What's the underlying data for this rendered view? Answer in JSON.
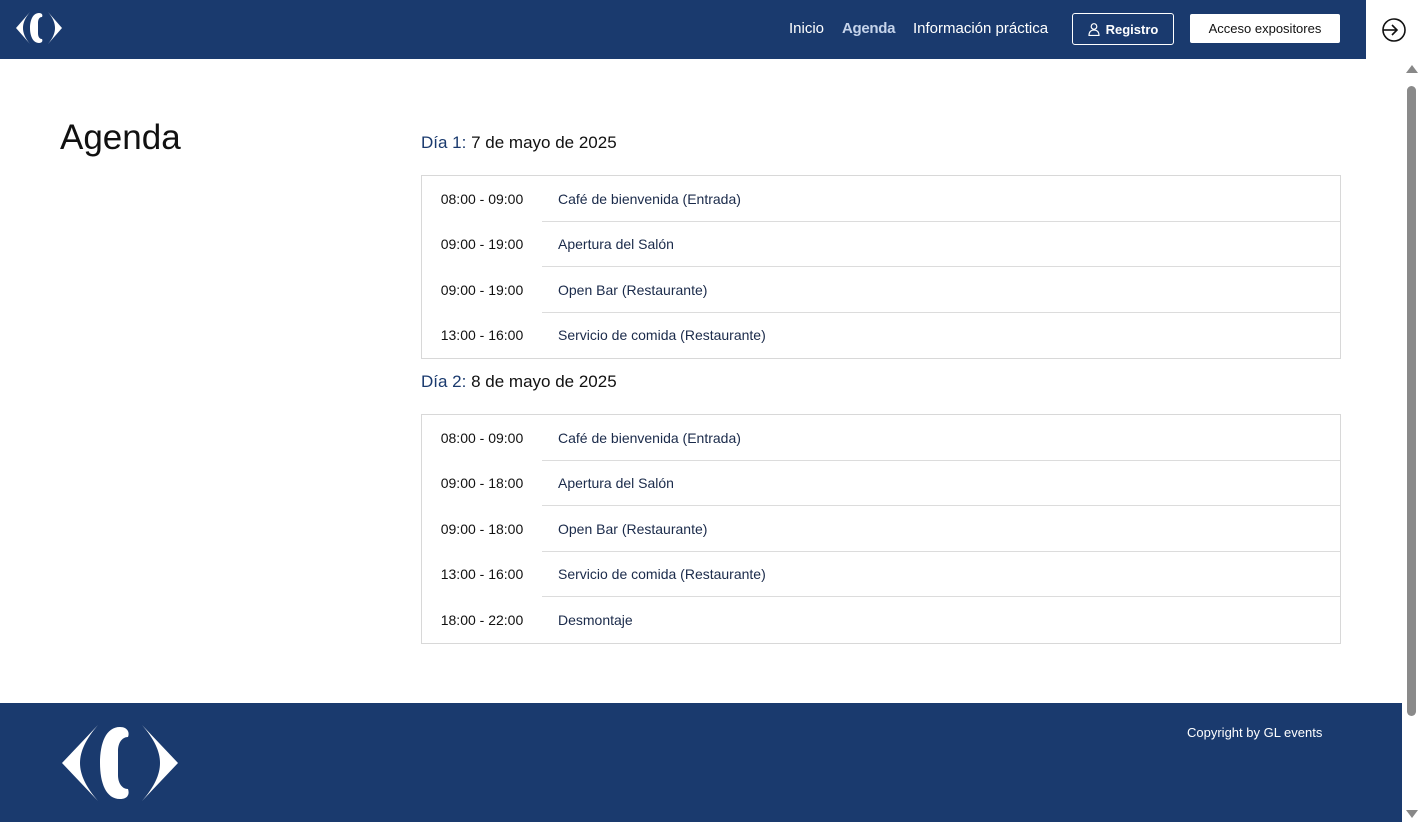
{
  "header": {
    "logo_icon": "carrefour-logo",
    "nav": [
      {
        "label": "Inicio",
        "active": false
      },
      {
        "label": "Agenda",
        "active": true
      },
      {
        "label": "Información práctica",
        "active": false
      }
    ],
    "registro_label": "Registro",
    "expositores_label": "Acceso expositores",
    "login_icon": "login-arrow-icon"
  },
  "main": {
    "title": "Agenda",
    "days": [
      {
        "prefix": "Día 1:",
        "date": "7 de mayo de 2025",
        "events": [
          {
            "time": "08:00 - 09:00",
            "name": "Café de bienvenida (Entrada)"
          },
          {
            "time": "09:00 - 19:00",
            "name": "Apertura del Salón"
          },
          {
            "time": "09:00 - 19:00",
            "name": "Open Bar (Restaurante)"
          },
          {
            "time": "13:00 - 16:00",
            "name": "Servicio de comida (Restaurante)"
          }
        ]
      },
      {
        "prefix": "Día 2:",
        "date": "8 de mayo de 2025",
        "events": [
          {
            "time": "08:00 - 09:00",
            "name": "Café de bienvenida (Entrada)"
          },
          {
            "time": "09:00 - 18:00",
            "name": "Apertura del Salón"
          },
          {
            "time": "09:00 - 18:00",
            "name": "Open Bar (Restaurante)"
          },
          {
            "time": "13:00 - 16:00",
            "name": "Servicio de comida (Restaurante)"
          },
          {
            "time": "18:00 - 22:00",
            "name": "Desmontaje"
          }
        ]
      }
    ]
  },
  "footer": {
    "copyright": "Copyright by GL events",
    "logo_icon": "carrefour-logo"
  },
  "colors": {
    "brand_blue": "#1a3a6e",
    "active_nav": "#c5d3ea"
  }
}
